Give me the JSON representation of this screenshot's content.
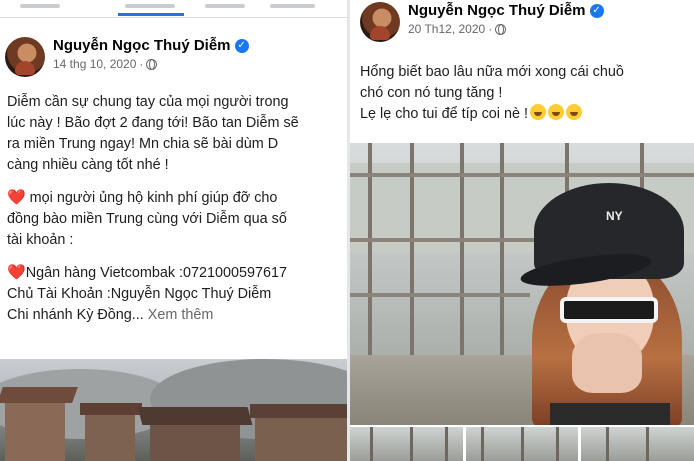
{
  "left_post": {
    "author": "Nguyễn Ngọc Thuý Diễm",
    "date": "14 thg 10, 2020",
    "separator": "·",
    "paragraph1": "Diễm cần sự chung tay của mọi người trong\nlúc này ! Bão đợt 2 đang tới! Bão tan Diễm sẽ\nra miền Trung ngay! Mn chia sẽ bài dùm D\ncàng nhiều càng tốt nhé !",
    "heart": "❤️",
    "paragraph2": " mọi người ủng hộ kinh phí giúp đỡ cho\nđồng bào miền Trung cùng với Diễm qua số\ntài khoản :",
    "bank_line": "Ngân hàng Vietcombak :0721000597617",
    "holder_line": "Chủ Tài Khoản :Nguyễn Ngọc Thuý Diễm",
    "branch_line": "Chi nhánh Kỳ Đồng...",
    "see_more": " Xem thêm"
  },
  "right_post": {
    "author": "Nguyễn Ngọc Thuý Diễm",
    "date": "20 Th12, 2020",
    "separator": "·",
    "line1": "Hổng biết bao lâu nữa mới xong cái chuồ",
    "line2": "chó con nó tung tăng !",
    "line3": "Lẹ lẹ cho tui để típ coi nè  !",
    "hat_logo": "NY"
  },
  "colors": {
    "accent": "#1877f2",
    "meta_text": "#65676b",
    "heart": "#e0245e"
  },
  "icons": {
    "verified": "verified-badge-icon",
    "privacy": "globe-icon",
    "emoji": "grinning-face-icon"
  }
}
